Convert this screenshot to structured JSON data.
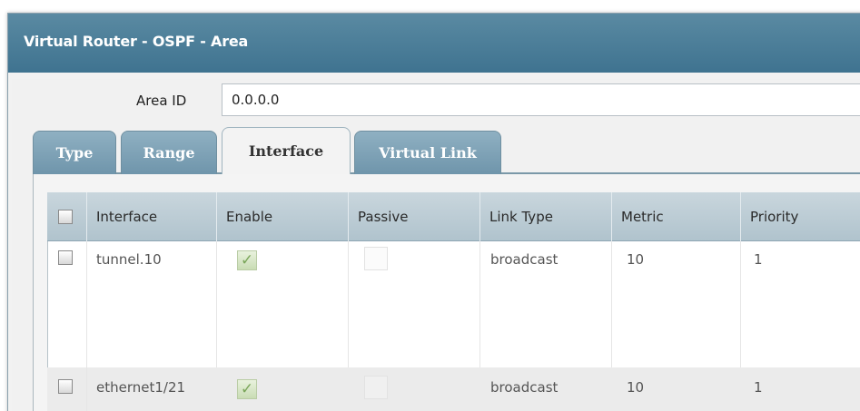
{
  "dialog": {
    "title": "Virtual Router - OSPF - Area"
  },
  "area": {
    "label": "Area ID",
    "value": "0.0.0.0"
  },
  "tabs": [
    {
      "label": "Type",
      "active": false
    },
    {
      "label": "Range",
      "active": false
    },
    {
      "label": "Interface",
      "active": true
    },
    {
      "label": "Virtual Link",
      "active": false
    }
  ],
  "table": {
    "columns": [
      "Interface",
      "Enable",
      "Passive",
      "Link Type",
      "Metric",
      "Priority"
    ],
    "rows": [
      {
        "interface": "tunnel.10",
        "enable": true,
        "passive": false,
        "link_type": "broadcast",
        "metric": "10",
        "priority": "1"
      },
      {
        "interface": "ethernet1/21",
        "enable": true,
        "passive": false,
        "link_type": "broadcast",
        "metric": "10",
        "priority": "1"
      }
    ]
  },
  "colors": {
    "titlebar": "#3f7390",
    "tab": "#7fa3b8",
    "header": "#b8c9d2",
    "check_green": "#7aa65a"
  },
  "icons": {
    "checked": "check-icon"
  }
}
